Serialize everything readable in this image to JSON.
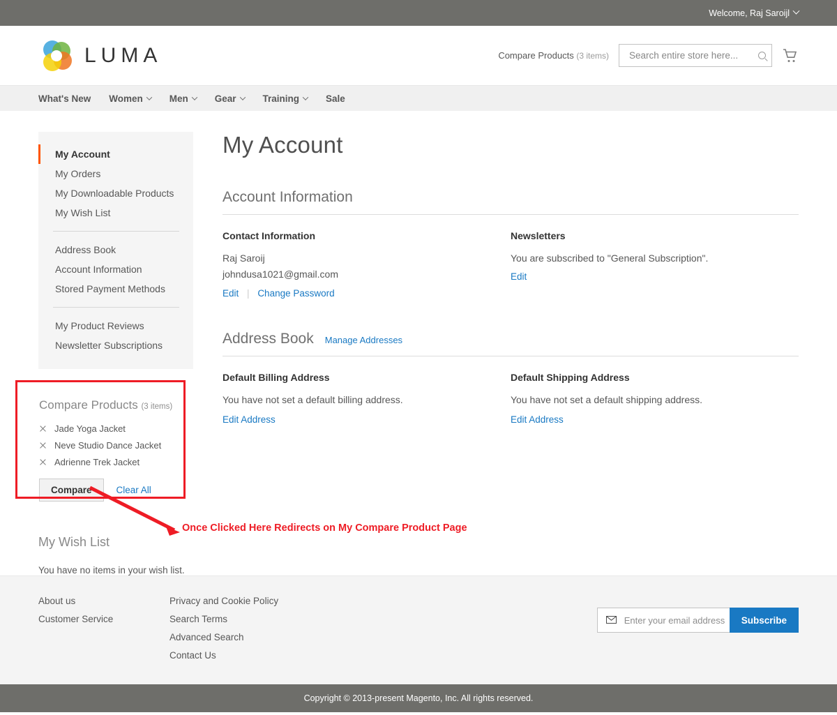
{
  "top_panel": {
    "welcome": "Welcome, Raj Saroijl",
    "chevron_icon": "chevron-down-icon"
  },
  "header": {
    "logo_text": "LUMA",
    "logo_icon": "luma-logo-icon",
    "compare_products_label": "Compare Products",
    "compare_products_count": "(3 items)",
    "search_placeholder": "Search entire store here...",
    "search_value": "",
    "search_icon": "search-icon",
    "cart_icon": "shopping-cart-icon"
  },
  "nav": {
    "items": [
      {
        "label": "What's New",
        "has_chevron": false
      },
      {
        "label": "Women",
        "has_chevron": true
      },
      {
        "label": "Men",
        "has_chevron": true
      },
      {
        "label": "Gear",
        "has_chevron": true
      },
      {
        "label": "Training",
        "has_chevron": true
      },
      {
        "label": "Sale",
        "has_chevron": false
      }
    ]
  },
  "sidebar": {
    "account_nav": {
      "group1": [
        {
          "label": "My Account",
          "current": true
        },
        {
          "label": "My Orders",
          "current": false
        },
        {
          "label": "My Downloadable Products",
          "current": false
        },
        {
          "label": "My Wish List",
          "current": false
        }
      ],
      "group2": [
        {
          "label": "Address Book",
          "current": false
        },
        {
          "label": "Account Information",
          "current": false
        },
        {
          "label": "Stored Payment Methods",
          "current": false
        }
      ],
      "group3": [
        {
          "label": "My Product Reviews",
          "current": false
        },
        {
          "label": "Newsletter Subscriptions",
          "current": false
        }
      ]
    },
    "compare_products": {
      "title": "Compare Products",
      "count": "(3 items)",
      "items": [
        {
          "name": "Jade Yoga Jacket",
          "remove_icon": "close-icon"
        },
        {
          "name": "Neve Studio Dance Jacket",
          "remove_icon": "close-icon"
        },
        {
          "name": "Adrienne Trek Jacket",
          "remove_icon": "close-icon"
        }
      ],
      "compare_button": "Compare",
      "clear_all_link": "Clear All"
    },
    "wish_list": {
      "title": "My Wish List",
      "empty_message": "You have no items in your wish list."
    }
  },
  "main": {
    "page_title": "My Account",
    "account_information": {
      "block_title": "Account Information",
      "contact": {
        "heading": "Contact Information",
        "name": "Raj Saroij",
        "email": "johndusa1021@gmail.com",
        "edit_link": "Edit",
        "change_password_link": "Change Password"
      },
      "newsletters": {
        "heading": "Newsletters",
        "status": "You are subscribed to \"General Subscription\".",
        "edit_link": "Edit"
      }
    },
    "address_book": {
      "block_title": "Address Book",
      "manage_link": "Manage Addresses",
      "billing": {
        "heading": "Default Billing Address",
        "message": "You have not set a default billing address.",
        "edit_link": "Edit Address"
      },
      "shipping": {
        "heading": "Default Shipping Address",
        "message": "You have not set a default shipping address.",
        "edit_link": "Edit Address"
      }
    }
  },
  "footer": {
    "column1": [
      {
        "label": "About us"
      },
      {
        "label": "Customer Service"
      }
    ],
    "column2": [
      {
        "label": "Privacy and Cookie Policy"
      },
      {
        "label": "Search Terms"
      },
      {
        "label": "Advanced Search"
      },
      {
        "label": "Contact Us"
      }
    ],
    "newsletter": {
      "envelope_icon": "envelope-icon",
      "placeholder": "Enter your email address",
      "value": "",
      "subscribe_button": "Subscribe"
    },
    "copyright": "Copyright © 2013-present Magento, Inc. All rights reserved."
  },
  "annotation": {
    "text": "Once Clicked Here Redirects on My Compare Product Page",
    "color": "#ee1c25"
  },
  "colors": {
    "accent_orange": "#ff5501",
    "link_blue": "#1979c3",
    "top_panel_gray": "#6e6e6a",
    "nav_gray": "#f0f0f0",
    "sidebar_gray": "#f5f5f5",
    "annotation_red": "#ee1c25"
  }
}
